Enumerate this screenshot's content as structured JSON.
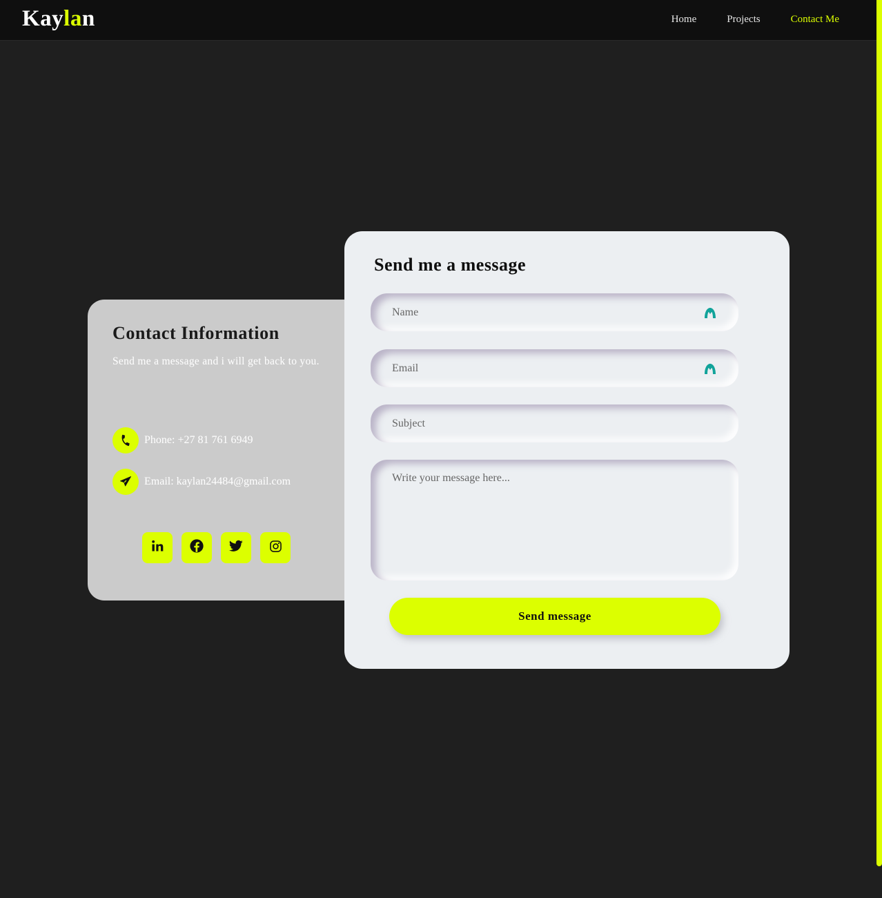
{
  "nav": {
    "logo_part1": "Kay",
    "logo_part2": "la",
    "logo_part3": "n",
    "links": [
      "Home",
      "Projects",
      "Contact Me"
    ],
    "active_link": "Contact Me"
  },
  "contact_info": {
    "title": "Contact Information",
    "subtitle": "Send me a message and i will get back to you.",
    "phone_label": "Phone: +27 81 761 6949",
    "email_label": "Email: kaylan24484@gmail.com",
    "socials": [
      "linkedin-icon",
      "facebook-icon",
      "twitter-icon",
      "instagram-icon"
    ]
  },
  "form": {
    "title": "Send me a message",
    "name_placeholder": "Name",
    "email_placeholder": "Email",
    "subject_placeholder": "Subject",
    "message_placeholder": "Write your message here...",
    "submit_label": "Send message"
  },
  "colors": {
    "accent": "#dcff00",
    "page_bg": "#1f1f1f",
    "nav_bg": "#0f0f0f",
    "info_card_bg": "#cbcbcb",
    "form_card_bg": "#eceff2",
    "field_badge": "#11a39a"
  }
}
